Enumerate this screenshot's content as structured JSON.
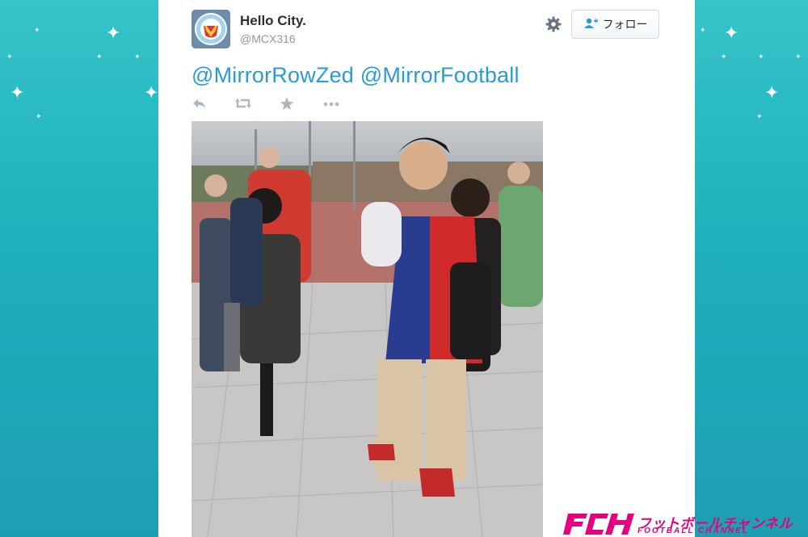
{
  "colors": {
    "background_teal": "#1fb0bb",
    "card": "#ffffff",
    "link_blue": "#2b9bd6",
    "brand_pink": "#e4007f"
  },
  "tweet": {
    "display_name": "Hello City.",
    "handle": "@MCX316",
    "text": "@MirrorRowZed @MirrorFootball",
    "follow_label": "フォロー",
    "icons": {
      "settings": "gear-icon",
      "follow": "add-user-icon",
      "reply": "reply-icon",
      "retweet": "retweet-icon",
      "favorite": "star-icon",
      "more": "more-icon"
    }
  },
  "watermark": {
    "jp": "フットボールチャンネル",
    "en": "FOOTBALL CHANNEL"
  }
}
